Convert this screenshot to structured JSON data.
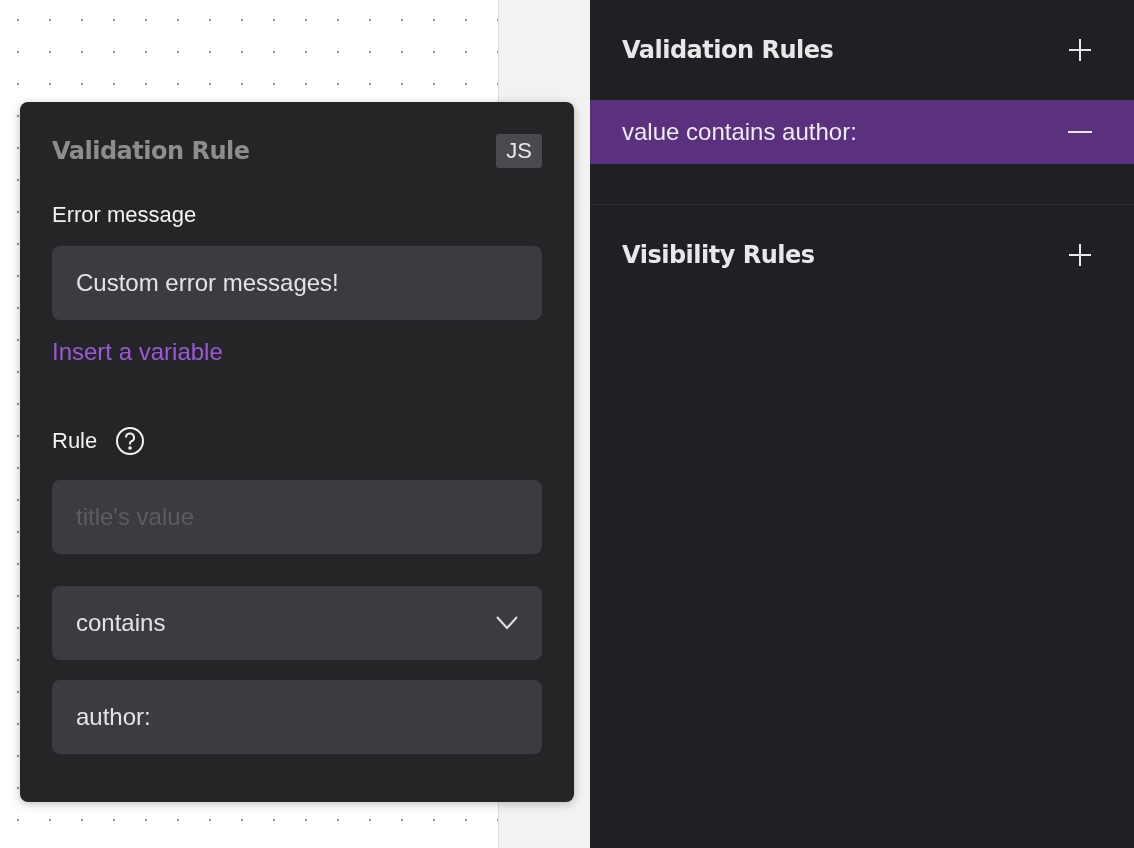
{
  "popup": {
    "title": "Validation Rule",
    "badge": "JS",
    "error_label": "Error message",
    "error_value": "Custom error messages!",
    "insert_link": "Insert a variable",
    "rule_label": "Rule",
    "rule_fields": [
      {
        "kind": "input",
        "placeholder": "title's value"
      },
      {
        "kind": "select",
        "value": "contains"
      },
      {
        "kind": "input",
        "value": "author:"
      }
    ]
  },
  "panel": {
    "sections": [
      {
        "title": "Validation Rules",
        "items": [
          {
            "label": "value contains author:",
            "selected": true
          }
        ]
      },
      {
        "title": "Visibility Rules"
      }
    ]
  }
}
